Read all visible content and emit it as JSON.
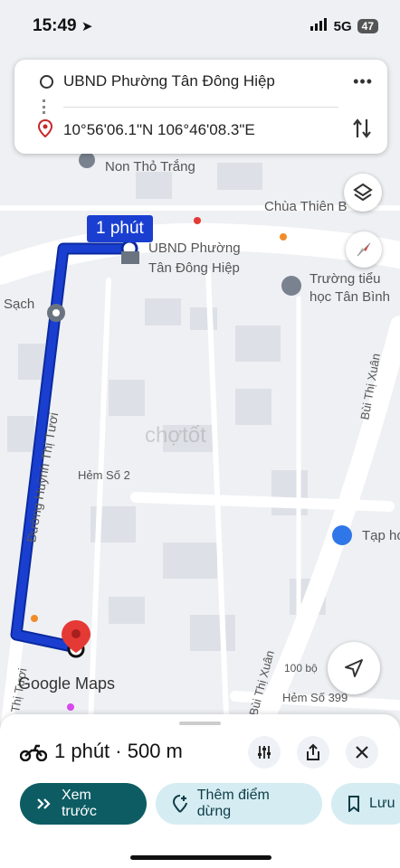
{
  "status_bar": {
    "time": "15:49",
    "network": "5G",
    "battery": "47"
  },
  "route": {
    "origin": "UBND Phường Tân Đông Hiệp",
    "destination": "10°56'06.1\"N 106°46'08.3\"E",
    "time_bubble": "1 phút"
  },
  "map": {
    "labels": {
      "school_non": "Non Thỏ Trắng",
      "chua": "Chùa Thiên B",
      "ubnd_line1": "UBND Phường",
      "ubnd_line2": "Tân Đông Hiệp",
      "truong_line1": "Trường tiểu",
      "truong_line2": "học Tân Bình",
      "sach": "Sạch",
      "duong": "Đường Huỳnh Thị Tươi",
      "hem2": "Hẻm Số 2",
      "bui_thi_xuan": "Bùi Thị Xuân",
      "bui_thi_xuan2": "Bùi Thị Xuân",
      "tap_hoa": "Tạp hó",
      "hem399": "Hẻm Số 399",
      "scale": "100 bộ",
      "left_road": "Thị Tươi",
      "watermark": "chợtốt",
      "google_maps": "Google Maps"
    }
  },
  "bottom_sheet": {
    "summary": "1 phút · 500 m",
    "preview_label": "Xem trước",
    "add_stop_label": "Thêm điểm dừng",
    "save_label": "Lưu"
  },
  "colors": {
    "route": "#1a3fd0",
    "accent_green": "#0d5c63",
    "pin_red": "#e53935"
  }
}
